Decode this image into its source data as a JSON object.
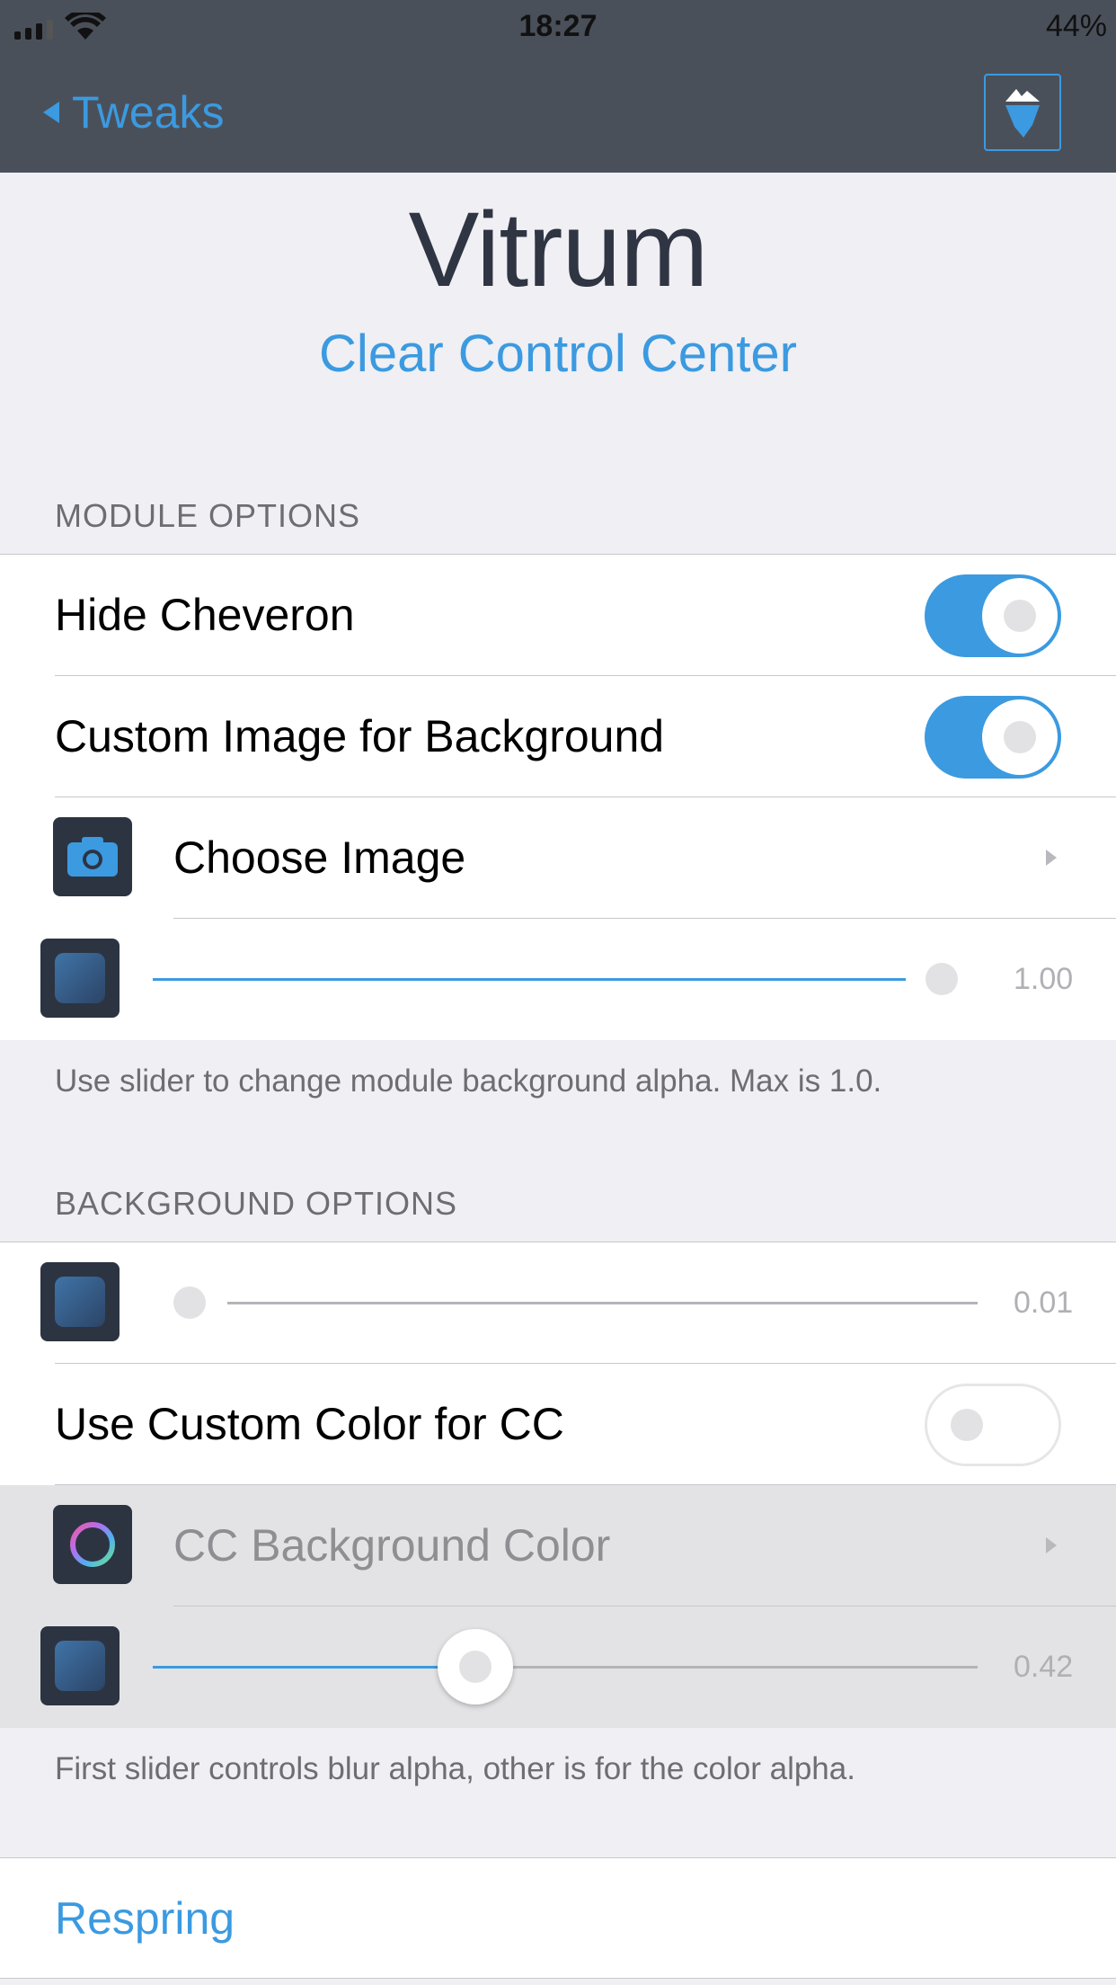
{
  "status_bar": {
    "time": "18:27",
    "battery": "44%"
  },
  "nav": {
    "back_label": "Tweaks",
    "icon": "iceberg-icon"
  },
  "header": {
    "title": "Vitrum",
    "subtitle": "Clear Control Center"
  },
  "module_options": {
    "heading": "MODULE OPTIONS",
    "hide_cheveron": {
      "label": "Hide Cheveron",
      "on": true
    },
    "custom_image": {
      "label": "Custom Image for Background",
      "on": true
    },
    "choose_image": {
      "label": "Choose Image",
      "icon": "camera-icon"
    },
    "alpha_slider": {
      "value": 1.0,
      "value_text": "1.00"
    },
    "footer": "Use slider to change module background alpha. Max is 1.0."
  },
  "background_options": {
    "heading": "BACKGROUND OPTIONS",
    "blur_slider": {
      "value": 0.01,
      "value_text": "0.01"
    },
    "custom_color": {
      "label": "Use Custom Color for CC",
      "on": false
    },
    "cc_background_color": {
      "label": "CC Background Color",
      "icon": "color-ring-icon"
    },
    "color_alpha_slider": {
      "value": 0.42,
      "value_text": "0.42"
    },
    "footer": "First slider controls blur alpha, other is for the color alpha."
  },
  "respring": {
    "label": "Respring"
  },
  "colors": {
    "accent": "#3b9ae0",
    "nav_bg": "#4a505a",
    "grouped_bg": "#efeff4"
  }
}
